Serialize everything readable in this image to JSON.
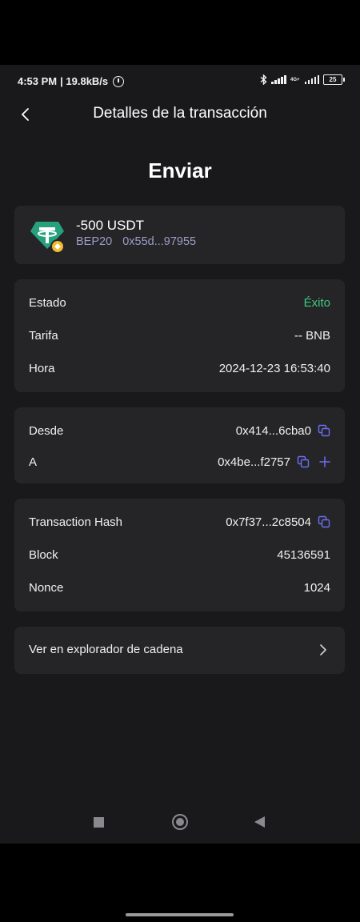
{
  "status_bar": {
    "time": "4:53 PM",
    "speed": "| 19.8kB/s",
    "network": "4G+",
    "battery": "25"
  },
  "header": {
    "title": "Detalles de la transacción",
    "back_icon": "chevron-left-icon"
  },
  "heading": "Enviar",
  "asset": {
    "amount": "-500 USDT",
    "network": "BEP20",
    "address": "0x55d...97955",
    "logo_icon": "tether-logo",
    "badge_icon": "bnb-badge"
  },
  "details": {
    "status_label": "Estado",
    "status_value": "Éxito",
    "fee_label": "Tarifa",
    "fee_value": "-- BNB",
    "time_label": "Hora",
    "time_value": "2024-12-23 16:53:40"
  },
  "addresses": {
    "from_label": "Desde",
    "from_value": "0x414...6cba0",
    "to_label": "A",
    "to_value": "0x4be...f2757"
  },
  "chain": {
    "hash_label": "Transaction Hash",
    "hash_value": "0x7f37...2c8504",
    "block_label": "Block",
    "block_value": "45136591",
    "nonce_label": "Nonce",
    "nonce_value": "1024"
  },
  "explorer": {
    "label": "Ver en explorador de cadena"
  },
  "colors": {
    "background": "#19191b",
    "card": "#252528",
    "success": "#3ec97e",
    "accent": "#6c6ff0",
    "tether": "#26a17b",
    "bnb": "#f3ba2f"
  }
}
